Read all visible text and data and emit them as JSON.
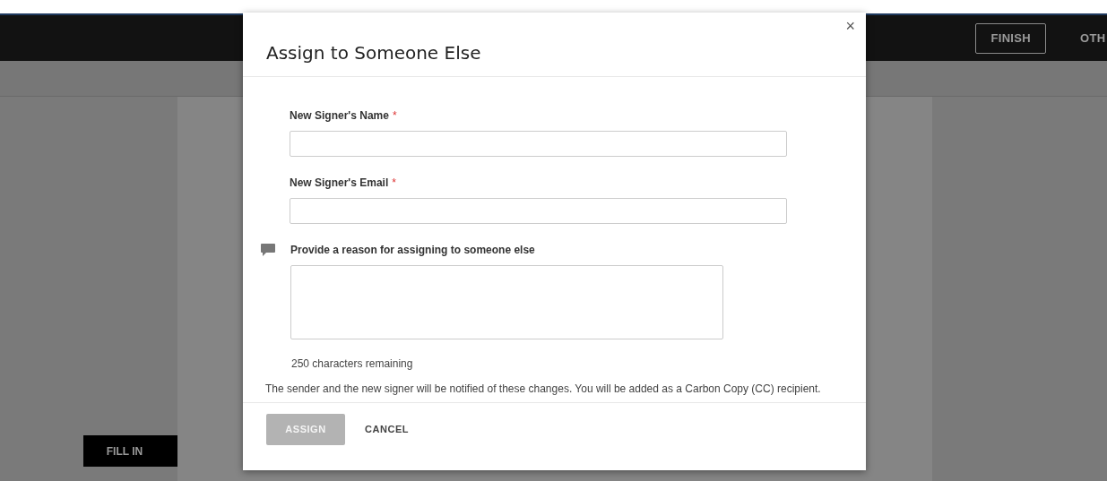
{
  "header": {
    "buttons": [
      {
        "label": "FINISH",
        "kind": "outline"
      },
      {
        "label": "OTH",
        "kind": "plain"
      }
    ]
  },
  "fill_in_tag": {
    "label": "FILL IN"
  },
  "dialog": {
    "title": "Assign to Someone Else",
    "close": "×",
    "fields": [
      {
        "label": "New Signer's Name",
        "required_mark": "*"
      },
      {
        "label": "New Signer's Email",
        "required_mark": "*"
      }
    ],
    "reason": {
      "label": "Provide a reason for assigning to someone else",
      "counter": "250 characters remaining"
    },
    "notice": "The sender and the new signer will be notified of these changes. You will be added as a Carbon Copy (CC) recipient.",
    "buttons": [
      {
        "label": "ASSIGN",
        "kind": "primary",
        "disabled": true
      },
      {
        "label": "CANCEL",
        "kind": "plain",
        "disabled": false
      }
    ]
  }
}
